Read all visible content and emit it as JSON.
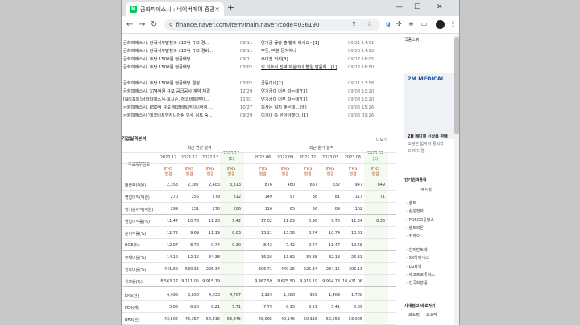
{
  "tab": {
    "title": "금화피에스시 : 네이버페이 증권",
    "close": "×",
    "new_tab": "+"
  },
  "window_controls": {
    "minimize": "—",
    "maximize": "☐",
    "close": "✕"
  },
  "address": {
    "url": "finance.naver.com/item/main.naver?code=036190"
  },
  "news": [
    {
      "title": "금화피에스시, 한국서부발전과 310억 규모 경...",
      "date": "09/11",
      "comment": "연기금 물량 출 빨리 파세요~[1]",
      "datetime": "09/21 14:01"
    },
    {
      "title": "금화피에스시, 한국서부발전과 310억 규모 경비...",
      "date": "09/11",
      "comment": "뿌듯, 맥분 뭉쳐하나",
      "datetime": "09/20 14:32"
    },
    {
      "title": "금화피에스시, 주당 1500원 현금배당",
      "date": "09/11",
      "comment": "주어진 거지[3]",
      "datetime": "09/17 16:05"
    },
    {
      "title": "금화피에스시, 주당 1500원 현금배당",
      "date": "03/02",
      "comment": "외 이주식 진짜 자살이네 빨양 닫음해...[1]",
      "datetime": "09/12 16:50",
      "underline": true
    },
    {
      "title": "금화피에스시, 주당 1500원 현금배당 결정",
      "date": "03/02",
      "comment": "급등이네[2]",
      "datetime": "09/11 13:58"
    },
    {
      "title": "금화피에스시, 374억원 규모 공급공사 계약 체결",
      "date": "12/29",
      "comment": "연기금이 너무 파는데?[3]",
      "datetime": "09/08 10:20"
    },
    {
      "title": "[N리포트]금화피에스시-효시즌, 에코비트엔지...",
      "date": "11/01",
      "comment": "연기금이 너무 파는데?[3]",
      "datetime": "09/08 10:20"
    },
    {
      "title": "금화피에스시, 850억 규모 에코비트엔지니어링 ...",
      "date": "10/27",
      "comment": "회사는 뭐지 좋은데....[6]",
      "datetime": "09/06 15:26"
    },
    {
      "title": "금화피에스시 '에코비트엔지니어링 인수 검토 중...",
      "date": "09/29",
      "comment": "이거나 좀 닫아야겠다..[1]",
      "datetime": "09/06 09:26"
    }
  ],
  "financials": {
    "heading": "기업실적분석",
    "more": "더보기",
    "corner": "주요재무정보",
    "annual_label": "최근 연간 실적",
    "quarter_label": "최근 분기 실적",
    "periods": [
      "2020.12",
      "2021.12",
      "2022.12",
      "2023.12",
      "2022.06",
      "2022.09",
      "2022.12",
      "2023.03",
      "2023.06",
      "2023.09"
    ],
    "est_mark": "(E)",
    "ifrs": "IFRS",
    "basis": "연결",
    "rows": [
      {
        "label": "매출액(억원)",
        "values": [
          "2,353",
          "2,387",
          "2,483",
          "3,313",
          "876",
          "480",
          "637",
          "832",
          "947",
          "849"
        ]
      },
      {
        "label": "영업이익(억원)",
        "values": [
          "270",
          "256",
          "279",
          "312",
          "149",
          "57",
          "38",
          "81",
          "117",
          "71"
        ]
      },
      {
        "label": "당기순이익(억원)",
        "values": [
          "299",
          "231",
          "278",
          "286",
          "116",
          "65",
          "56",
          "89",
          "102",
          ""
        ]
      },
      {
        "label": "영업이익률(%)",
        "values": [
          "11.47",
          "10.73",
          "11.23",
          "9.42",
          "17.02",
          "11.85",
          "5.98",
          "9.75",
          "12.34",
          "8.36"
        ]
      },
      {
        "label": "순이익률(%)",
        "values": [
          "12.72",
          "9.69",
          "11.19",
          "8.63",
          "13.21",
          "13.56",
          "8.74",
          "10.74",
          "10.81",
          ""
        ]
      },
      {
        "label": "ROE(%)",
        "values": [
          "12.07",
          "8.72",
          "9.74",
          "9.30",
          "8.43",
          "7.42",
          "9.74",
          "11.47",
          "10.48",
          ""
        ]
      },
      {
        "label": "부채비율(%)",
        "values": [
          "14.19",
          "12.16",
          "34.38",
          "",
          "16.26",
          "13.82",
          "34.38",
          "32.18",
          "26.33",
          ""
        ]
      },
      {
        "label": "당좌비율(%)",
        "values": [
          "441.69",
          "539.36",
          "225.34",
          "",
          "306.71",
          "440.25",
          "225.34",
          "234.15",
          "306.13",
          ""
        ]
      },
      {
        "label": "유보율(%)",
        "values": [
          "8,563.17",
          "9,111.05",
          "9,915.19",
          "",
          "9,467.59",
          "9,675.50",
          "9,915.19",
          "9,954.78",
          "10,431.06",
          ""
        ]
      },
      {
        "label": "EPS(원)",
        "values": [
          "4,993",
          "3,858",
          "4,633",
          "4,767",
          "1,929",
          "1,086",
          "929",
          "1,489",
          "1,708",
          ""
        ]
      },
      {
        "label": "PER(배)",
        "values": [
          "5.83",
          "8.26",
          "6.21",
          "5.71",
          "7.79",
          "8.15",
          "6.21",
          "5.41",
          "5.89",
          ""
        ]
      },
      {
        "label": "BPS(원)",
        "values": [
          "43,506",
          "46,357",
          "50,316",
          "53,845",
          "48,095",
          "49,146",
          "50,316",
          "50,558",
          "53,005",
          ""
        ]
      }
    ]
  },
  "sidebar": {
    "top_label": "국증스퀴",
    "ad_logo": "2M MEDICAL",
    "ad_title": "2H 메디컬 신상품 판매",
    "ad_line1": "조광된 힘이서 활피쇠",
    "ad_line2": "2H메디컬",
    "popular_title": "인기검색종목",
    "popular_tab": "코스피",
    "popular": [
      "셀트",
      "삼성전자",
      "POSCO홀딩스",
      "셀트리온",
      "카카오"
    ],
    "popular2": [
      "한미반도체",
      "SK하이닉스",
      "LG화학",
      "에코프로좋쳐스",
      "한국화장품"
    ],
    "bottom_title": "사새정보 바로가기",
    "bottom_tabs": [
      "코스피",
      "코스닥"
    ]
  },
  "colors": {
    "ifrs": "#c05020",
    "estimate_bg": "#f3faf0",
    "naver_green": "#03c75a"
  }
}
